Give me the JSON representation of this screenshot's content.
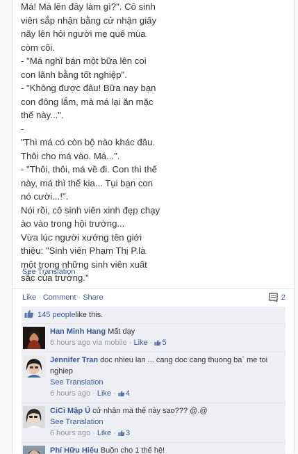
{
  "post": {
    "lines": [
      "Má! Má lên đây làm gì?\". Cô sinh",
      "viên sắp nhận bằng cử nhận giấy",
      "nãy lên hỏi người mẹ quê mùa",
      "còm cõi.",
      "- \"Má nghĩ bán một bữa lên coi",
      "con lãnh bằng tốt nghiệp\".",
      "- \"Không được đâu! Bữa nay bạn",
      "con đông lắm, mà má lại ăn mặc",
      "thế này...\".",
      "-",
      "\"Thì má có còn bộ nào khác đâu.",
      "Thôi cho má vào. Má...\".",
      "- \"Thôi, thôi, má về đi. Con thì thế",
      "này, má thì thế kia... Tụi bạn con",
      "nó cười...!\".",
      "Nói rồi, cô sinh viên xinh đẹp chạy",
      "ào vào trong hội trường...",
      "Vừa lúc người xướng tên giới",
      "thiệu: \"Sinh viên Phạm Thị P.là",
      "một trong những sinh viên xuất",
      "sắc của trường.\""
    ],
    "see_translation": "See Translation"
  },
  "actions": {
    "like": "Like",
    "comment": "Comment",
    "share": "Share",
    "separator": "·",
    "comment_count": "2"
  },
  "likes": {
    "count_link": "145 people",
    "suffix": " like this."
  },
  "comments": [
    {
      "author": "Han Minh Hang",
      "text": "Mất dạy",
      "time": "6 hours ago via mobile",
      "like": "Like",
      "likes": "5"
    },
    {
      "author": "Jennifer Tran",
      "text": "doc nhieu lan ... cang doc cang thuong ba` me toi nghiep",
      "see_translation": "See Translation",
      "time": "6 hours ago",
      "like": "Like",
      "likes": "4"
    },
    {
      "author": "CiCi Mập Ú",
      "text": "cử nhân mà thế này sao??? @.@",
      "see_translation": "See Translation",
      "time": "6 hours ago",
      "like": "Like",
      "likes": "3"
    },
    {
      "author": "Phí Hữu Hiếu",
      "text": "Buồn cho 1 thế hệ!"
    }
  ],
  "colors": {
    "link": "#3b5998",
    "panel": "#edeff4",
    "meta": "#999999"
  }
}
